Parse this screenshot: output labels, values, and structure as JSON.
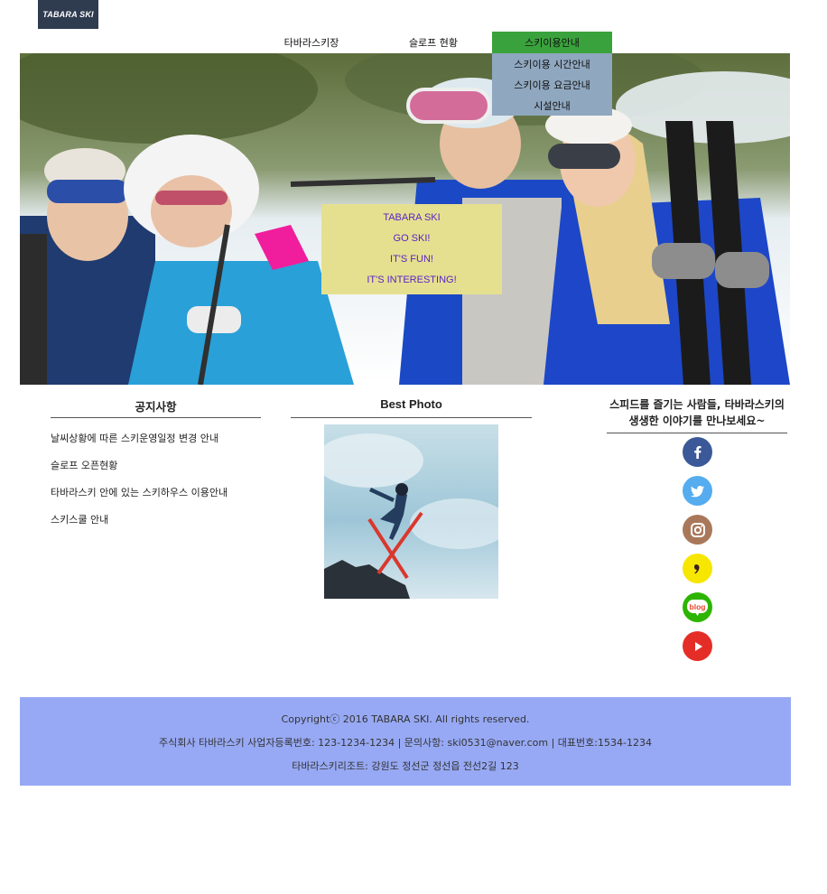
{
  "logo": {
    "text": "TABARA SKI"
  },
  "nav": {
    "items": [
      {
        "label": "타바라스키장"
      },
      {
        "label": "슬로프 현황"
      },
      {
        "label": "스키이용안내"
      }
    ],
    "dropdown": [
      {
        "label": "스키이용 시간안내"
      },
      {
        "label": "스키이용 요금안내"
      },
      {
        "label": "시설안내"
      }
    ],
    "active_color": "#3aa23c",
    "dropdown_color": "#8fa7bf"
  },
  "hero": {
    "lines": [
      "TABARA SKI",
      "GO SKI!",
      "IT'S FUN!",
      "IT'S INTERESTING!"
    ],
    "box_color": "#e5e08f",
    "text_color": "#5a22c8"
  },
  "notice": {
    "title": "공지사항",
    "items": [
      "날씨상황에 따른 스키운영일정 변경 안내",
      "슬로프 오픈현황",
      "타바라스키 안에 있는 스키하우스 이용안내",
      "스키스쿨 안내"
    ]
  },
  "best_photo": {
    "title": "Best Photo"
  },
  "social": {
    "title": "스피드를 즐기는 사람들, 타바라스키의 생생한 이야기를 만나보세요~",
    "icons": [
      {
        "name": "facebook-icon",
        "color": "#3b5998"
      },
      {
        "name": "twitter-icon",
        "color": "#55acee"
      },
      {
        "name": "instagram-icon",
        "color": "#a9785a"
      },
      {
        "name": "kakaostory-icon",
        "color": "#f7e600"
      },
      {
        "name": "blog-icon",
        "color": "#2db400",
        "text": "blog"
      },
      {
        "name": "youtube-icon",
        "color": "#e52d27"
      }
    ]
  },
  "footer": {
    "copyright": "Copyrightⓒ 2016 TABARA SKI. All rights reserved.",
    "company": "주식회사 타바라스키 사업자등록번호: 123-1234-1234 | 문의사항: ski0531@naver.com | 대표번호:1534-1234",
    "address": "타바라스키리조트: 강원도 정선군 정선읍 전선2길 123",
    "bg_color": "#97a9f4"
  }
}
